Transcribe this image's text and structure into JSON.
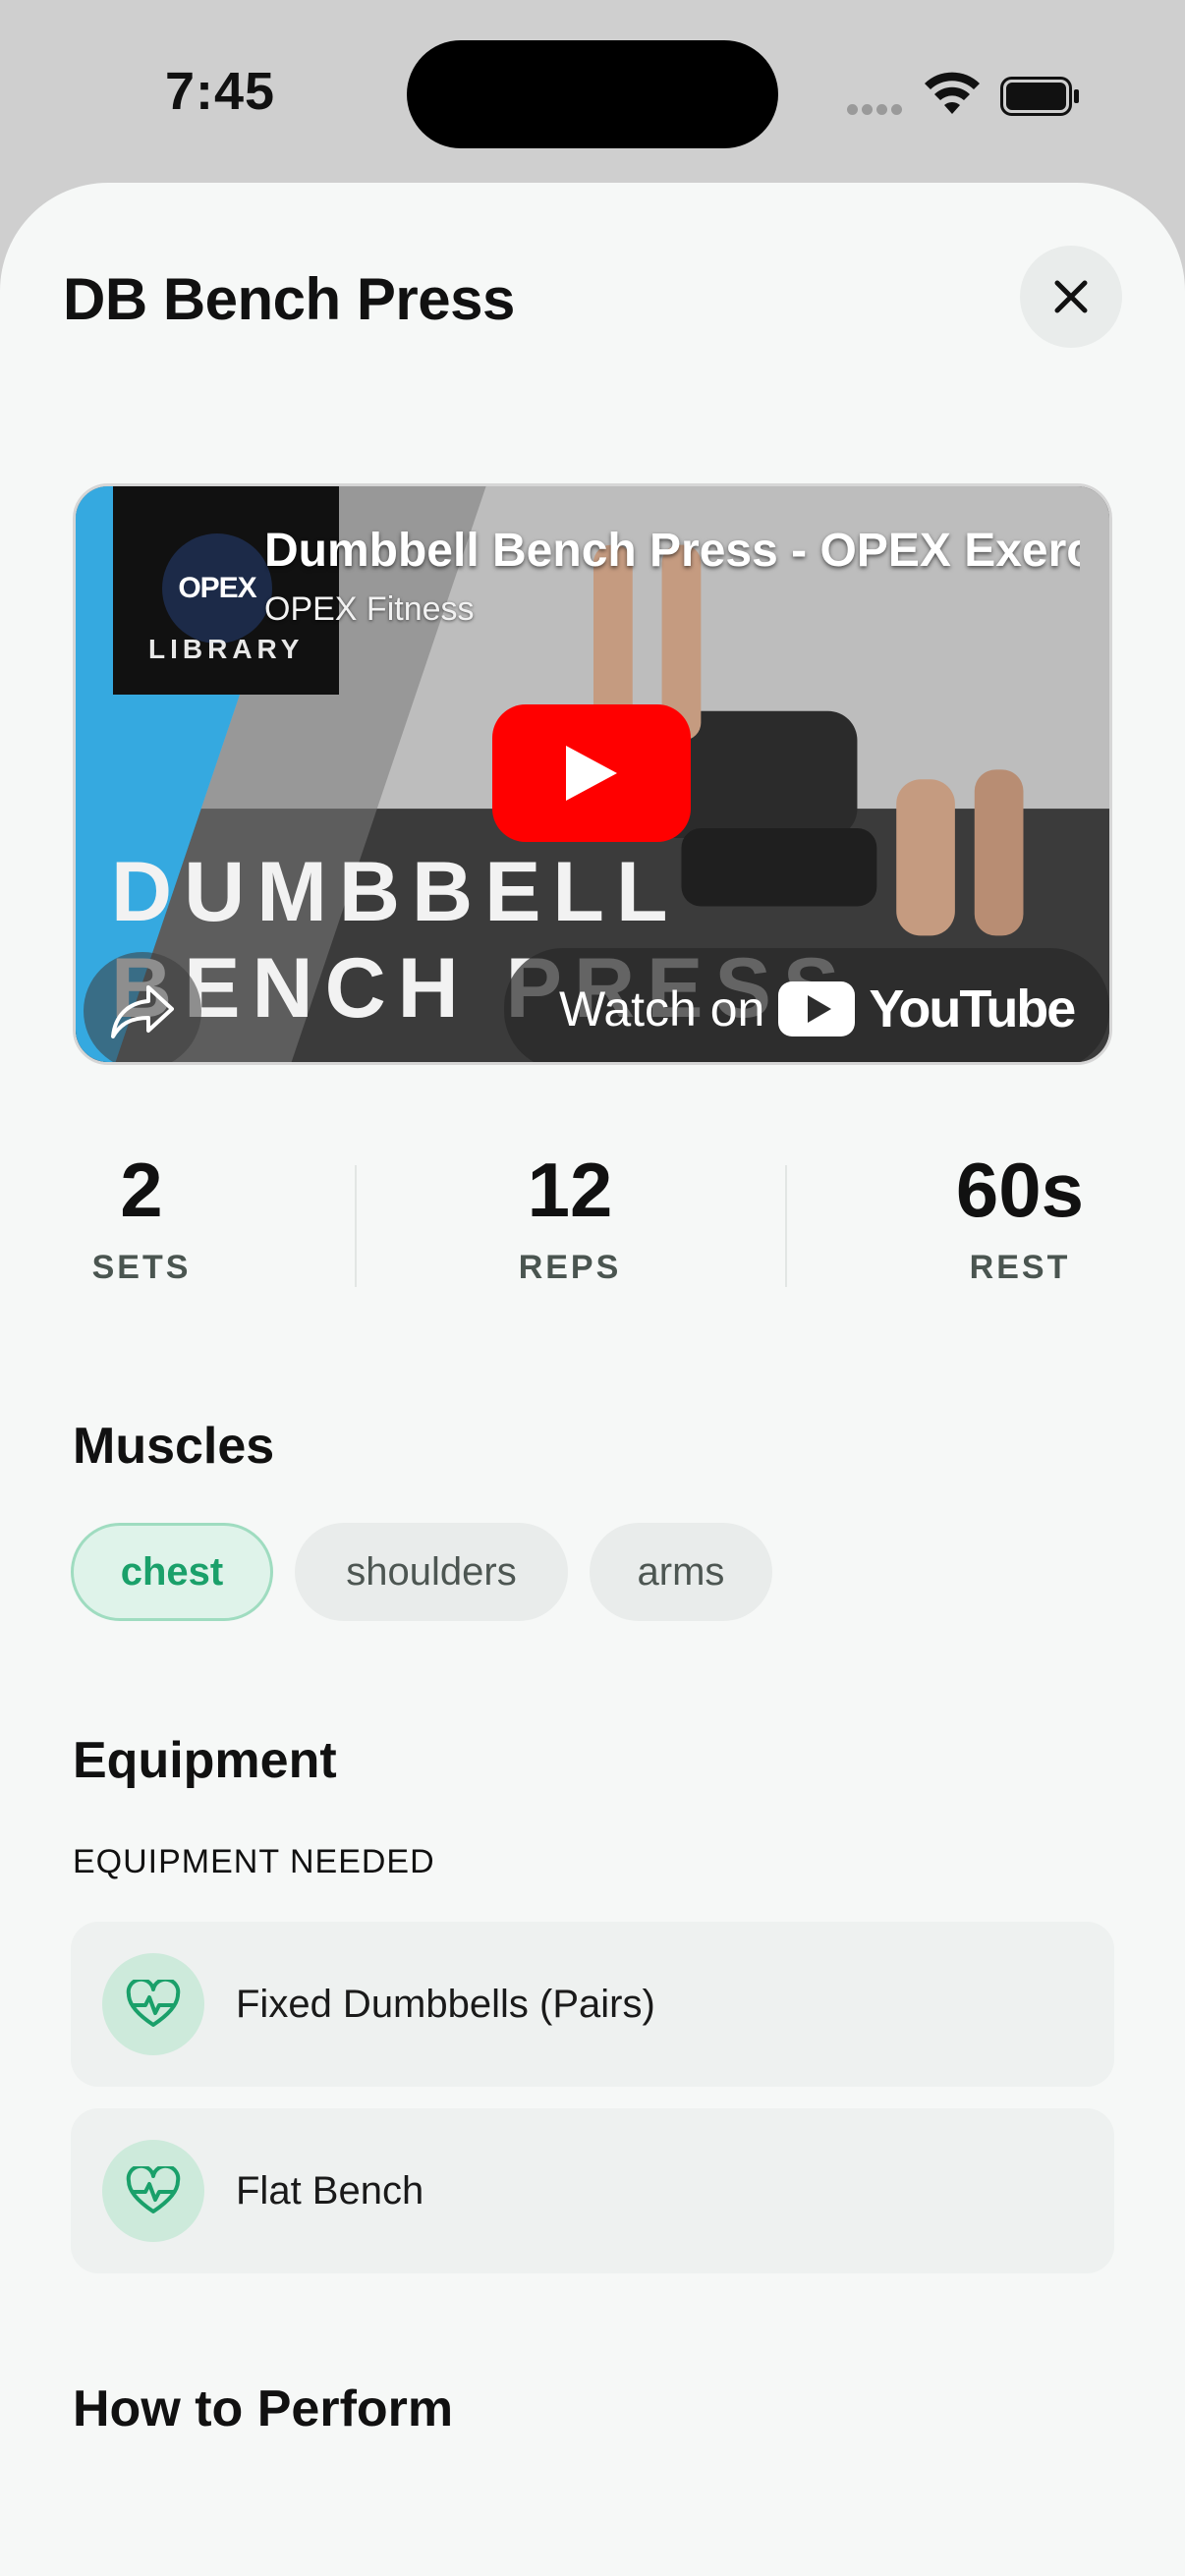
{
  "status": {
    "time": "7:45"
  },
  "sheet": {
    "title": "DB Bench Press"
  },
  "video": {
    "title": "Dumbbell Bench Press - OPEX Exercise Library",
    "channel": "OPEX Fitness",
    "channel_logo_text": "OPEX",
    "channel_logo_sub": "LIBRARY",
    "overlay_line1": "DUMBBELL",
    "overlay_line2": "BENCH PRESS",
    "watch_on": "Watch on",
    "youtube": "YouTube"
  },
  "stats": [
    {
      "value": "2",
      "label": "SETS"
    },
    {
      "value": "12",
      "label": "REPS"
    },
    {
      "value": "60s",
      "label": "REST"
    }
  ],
  "muscles": {
    "title": "Muscles",
    "chips": [
      "chest",
      "shoulders",
      "arms"
    ]
  },
  "equipment": {
    "title": "Equipment",
    "subtitle": "EQUIPMENT NEEDED",
    "items": [
      "Fixed Dumbbells (Pairs)",
      "Flat Bench"
    ]
  },
  "how_to": {
    "title": "How to Perform"
  },
  "colors": {
    "accent": "#1aa06a",
    "chip_active_bg": "#dff3ea",
    "youtube_red": "#ff0000"
  }
}
